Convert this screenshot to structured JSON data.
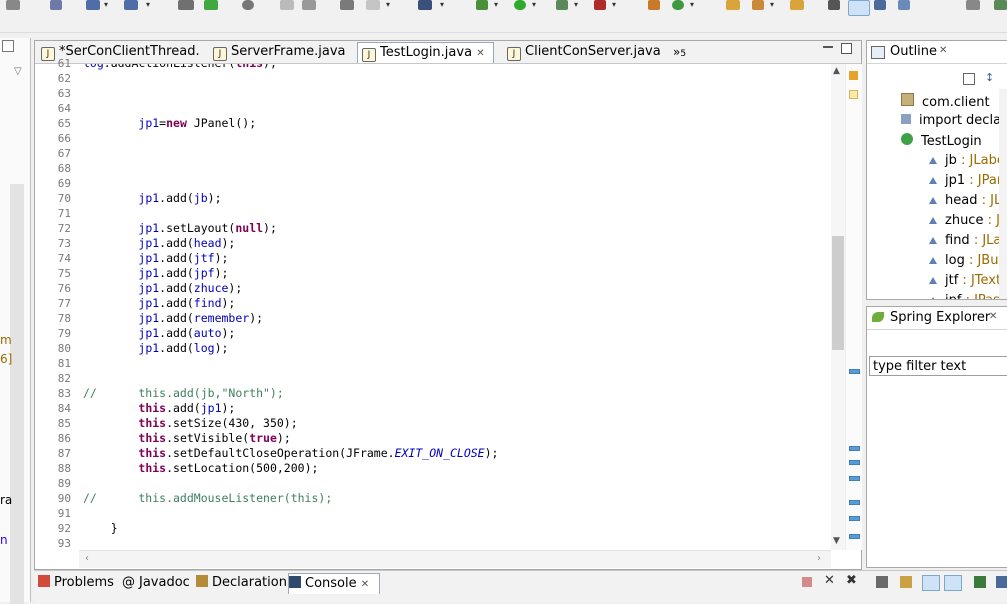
{
  "editor": {
    "tabs": [
      {
        "label": "*SerConClientThread.",
        "active": false
      },
      {
        "label": "ServerFrame.java",
        "active": false
      },
      {
        "label": "TestLogin.java",
        "active": true
      },
      {
        "label": "ClientConServer.java",
        "active": false
      }
    ],
    "overflow_label": "»",
    "overflow_count": "5",
    "close_glyph": "✕",
    "lines": [
      {
        "n": "61",
        "html": "<span class='var'>log</span>.addActionListener(<span class='kw'>this</span>);"
      },
      {
        "n": "62",
        "html": ""
      },
      {
        "n": "63",
        "html": ""
      },
      {
        "n": "64",
        "html": ""
      },
      {
        "n": "65",
        "html": "        <span class='var'>jp1</span>=<span class='kw'>new</span> JPanel();"
      },
      {
        "n": "66",
        "html": ""
      },
      {
        "n": "67",
        "html": ""
      },
      {
        "n": "68",
        "html": ""
      },
      {
        "n": "69",
        "html": ""
      },
      {
        "n": "70",
        "html": "        <span class='var'>jp1</span>.add(<span class='var'>jb</span>);"
      },
      {
        "n": "71",
        "html": ""
      },
      {
        "n": "72",
        "html": "        <span class='var'>jp1</span>.setLayout(<span class='kw'>null</span>);"
      },
      {
        "n": "73",
        "html": "        <span class='var'>jp1</span>.add(<span class='var'>head</span>);"
      },
      {
        "n": "74",
        "html": "        <span class='var'>jp1</span>.add(<span class='var'>jtf</span>);"
      },
      {
        "n": "75",
        "html": "        <span class='var'>jp1</span>.add(<span class='var'>jpf</span>);"
      },
      {
        "n": "76",
        "html": "        <span class='var'>jp1</span>.add(<span class='var'>zhuce</span>);"
      },
      {
        "n": "77",
        "html": "        <span class='var'>jp1</span>.add(<span class='var'>find</span>);"
      },
      {
        "n": "78",
        "html": "        <span class='var'>jp1</span>.add(<span class='var'>remember</span>);"
      },
      {
        "n": "79",
        "html": "        <span class='var'>jp1</span>.add(<span class='var'>auto</span>);"
      },
      {
        "n": "80",
        "html": "        <span class='var'>jp1</span>.add(<span class='var'>log</span>);"
      },
      {
        "n": "81",
        "html": ""
      },
      {
        "n": "82",
        "html": ""
      },
      {
        "n": "83",
        "html": "<span class='com'>//      this.add(jb,\"North\");</span>"
      },
      {
        "n": "84",
        "html": "        <span class='kw'>this</span>.add(<span class='var'>jp1</span>);"
      },
      {
        "n": "85",
        "html": "        <span class='kw'>this</span>.setSize(430, 350);"
      },
      {
        "n": "86",
        "html": "        <span class='kw'>this</span>.setVisible(<span class='kw'>true</span>);"
      },
      {
        "n": "87",
        "html": "        <span class='kw'>this</span>.setDefaultCloseOperation(JFrame.<span class='cst'>EXIT_ON_CLOSE</span>);"
      },
      {
        "n": "88",
        "html": "        <span class='kw'>this</span>.setLocation(500,200);"
      },
      {
        "n": "89",
        "html": ""
      },
      {
        "n": "90",
        "html": "<span class='com'>//      this.addMouseListener(this);</span>"
      },
      {
        "n": "91",
        "html": ""
      },
      {
        "n": "92",
        "html": "    }"
      },
      {
        "n": "93",
        "html": ""
      }
    ]
  },
  "outline": {
    "title": "Outline",
    "items": [
      {
        "label": "com.client",
        "type": "",
        "icon": "package-icon"
      },
      {
        "label": "import declara",
        "type": "",
        "icon": "import-icon"
      },
      {
        "label": "TestLogin",
        "type": "",
        "icon": "class-icon"
      },
      {
        "label": "jb",
        "type": " : JLabel",
        "icon": "field-icon"
      },
      {
        "label": "jp1",
        "type": " : JPanel",
        "icon": "field-icon"
      },
      {
        "label": "head",
        "type": " : JLa",
        "icon": "field-icon"
      },
      {
        "label": "zhuce",
        "type": " : JLa",
        "icon": "field-icon"
      },
      {
        "label": "find",
        "type": " : JLab",
        "icon": "field-icon"
      },
      {
        "label": "log",
        "type": " : JButt",
        "icon": "field-icon"
      },
      {
        "label": "jtf",
        "type": " : JTextF",
        "icon": "field-icon"
      },
      {
        "label": "jpf",
        "type": " : JPass",
        "icon": "field-icon"
      }
    ]
  },
  "spring": {
    "title": "Spring Explorer",
    "filter_placeholder": "type filter text"
  },
  "bottom": {
    "tabs": [
      {
        "label": "Problems",
        "active": false
      },
      {
        "label": "Javadoc",
        "active": false
      },
      {
        "label": "Declaration",
        "active": false
      },
      {
        "label": "Console",
        "active": true
      }
    ]
  },
  "leftstrip": {
    "fragments": [
      "m",
      "6]",
      "ra",
      "n"
    ]
  },
  "colors": {
    "keyword": "#7f0055",
    "field": "#0000c0",
    "comment": "#3f7f5f",
    "accent": "#5b9bd5"
  }
}
